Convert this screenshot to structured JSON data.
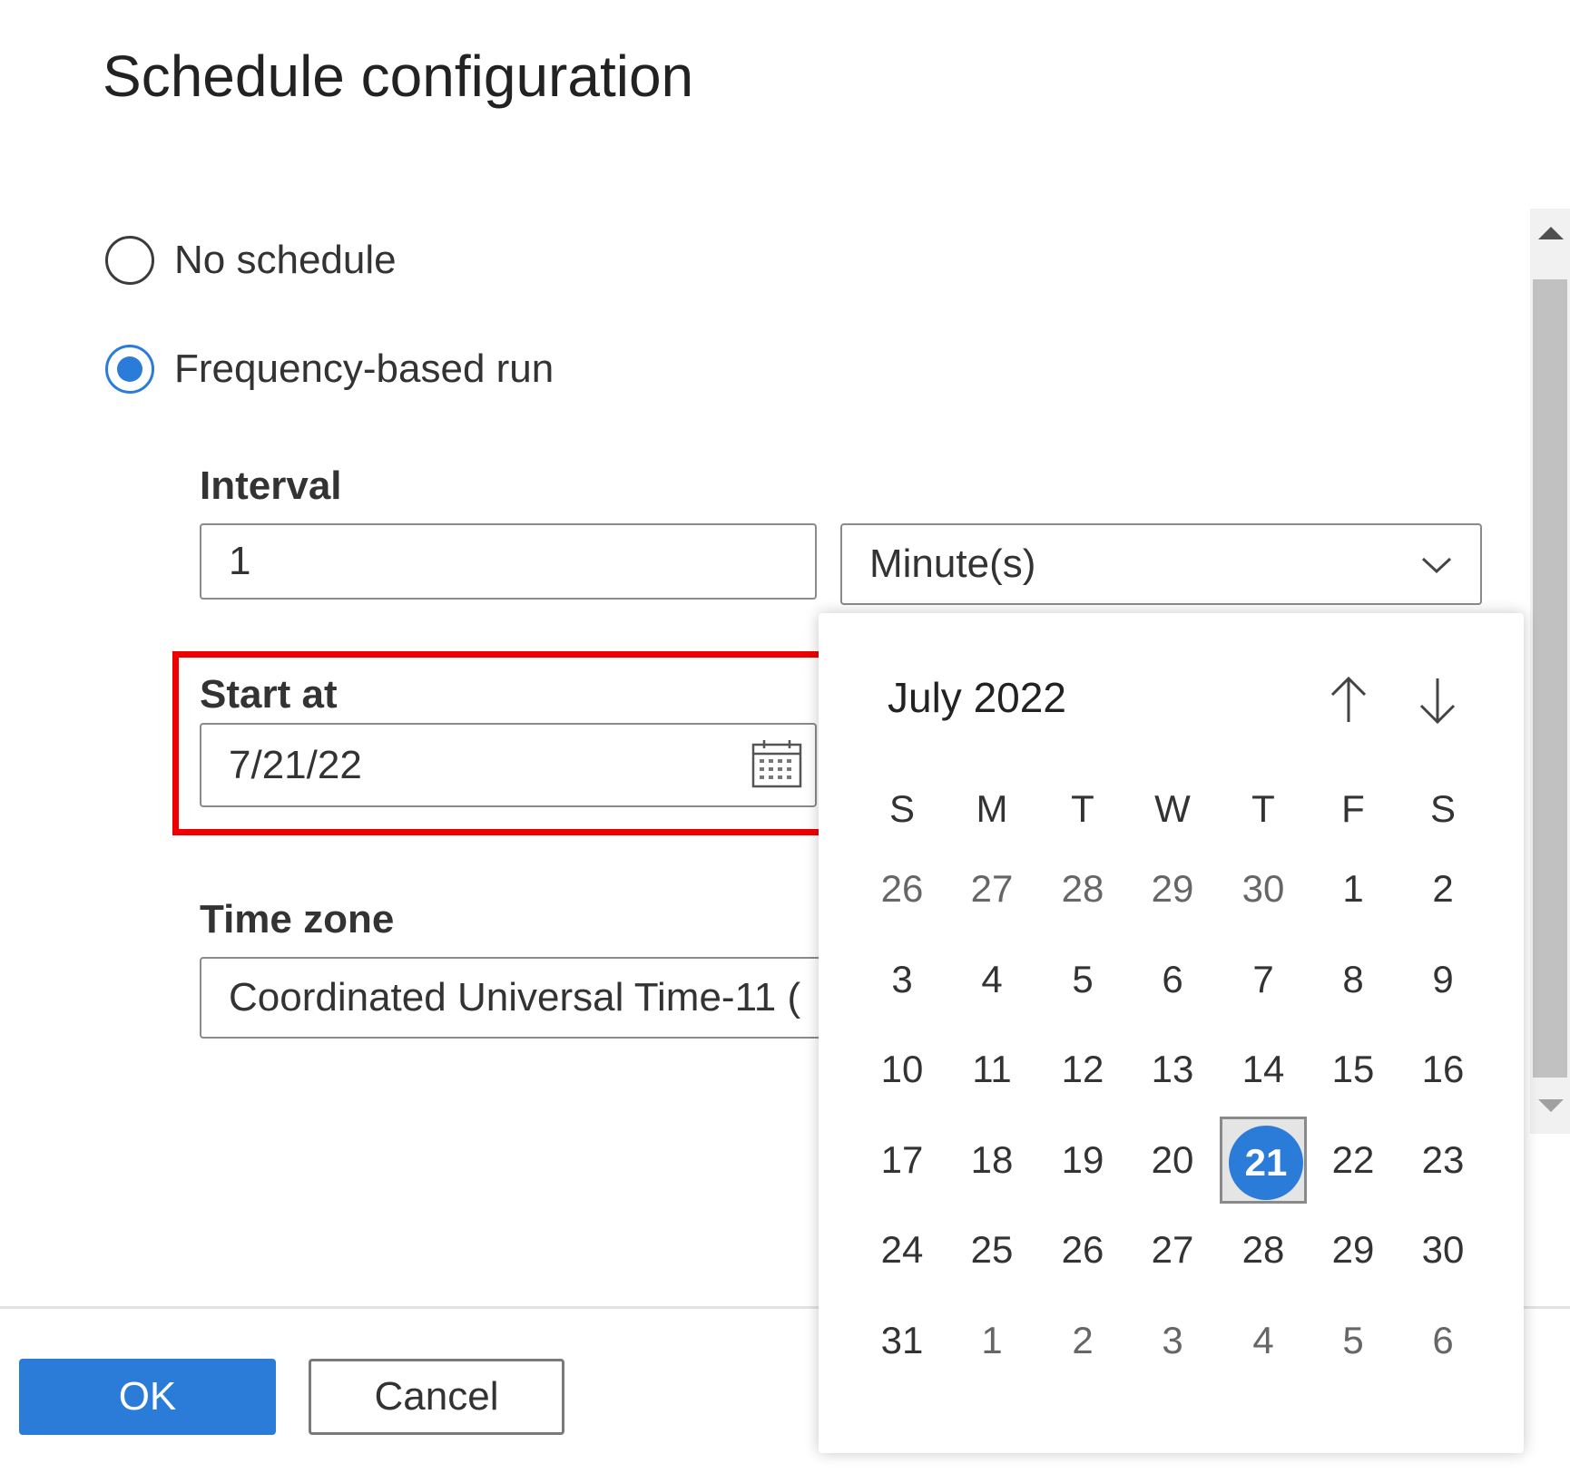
{
  "dialog": {
    "title": "Schedule configuration"
  },
  "schedule_options": [
    {
      "label": "No schedule",
      "selected": false
    },
    {
      "label": "Frequency-based run",
      "selected": true
    }
  ],
  "interval": {
    "label": "Interval",
    "value": "1",
    "unit": "Minute(s)"
  },
  "start_at": {
    "label": "Start at",
    "value": "7/21/22"
  },
  "time_zone": {
    "label": "Time zone",
    "value": "Coordinated Universal Time-11 ("
  },
  "calendar": {
    "month_label": "July 2022",
    "weekdays": [
      "S",
      "M",
      "T",
      "W",
      "T",
      "F",
      "S"
    ],
    "weeks": [
      [
        "26",
        "27",
        "28",
        "29",
        "30",
        "1",
        "2"
      ],
      [
        "3",
        "4",
        "5",
        "6",
        "7",
        "8",
        "9"
      ],
      [
        "10",
        "11",
        "12",
        "13",
        "14",
        "15",
        "16"
      ],
      [
        "17",
        "18",
        "19",
        "20",
        "21",
        "22",
        "23"
      ],
      [
        "24",
        "25",
        "26",
        "27",
        "28",
        "29",
        "30"
      ],
      [
        "31",
        "1",
        "2",
        "3",
        "4",
        "5",
        "6"
      ]
    ],
    "selected_day": "21",
    "accent_color": "#2b7cd9"
  },
  "footer": {
    "ok_label": "OK",
    "cancel_label": "Cancel"
  },
  "highlight_color": "#ee0000"
}
